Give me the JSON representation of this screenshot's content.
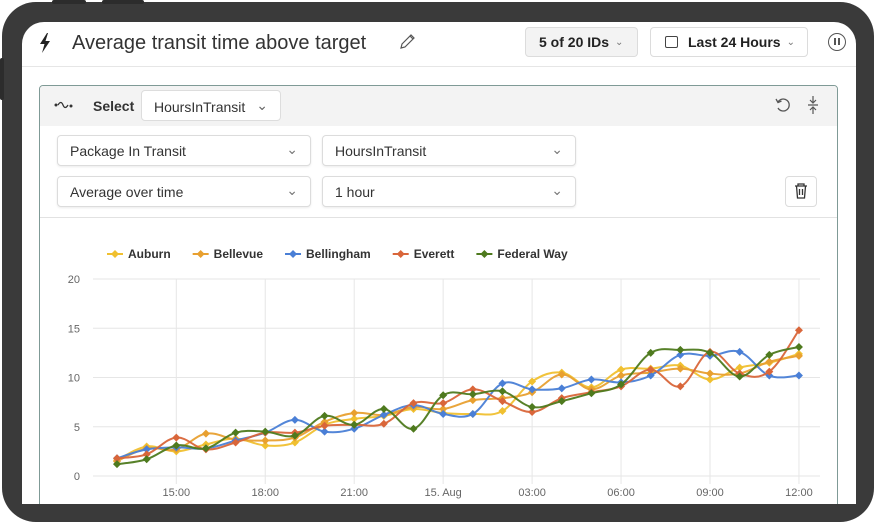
{
  "header": {
    "title": "Average transit time above target",
    "ids_selector": "5 of 20 IDs",
    "time_range": "Last 24 Hours"
  },
  "panel": {
    "select_label": "Select",
    "metric": "HoursInTransit",
    "dropdowns": {
      "entity": "Package In Transit",
      "property": "HoursInTransit",
      "aggregation": "Average over time",
      "interval": "1 hour"
    }
  },
  "icons": {
    "bolt": "lightning-icon",
    "edit": "pencil-icon",
    "calendar": "calendar-icon",
    "pause": "pause-icon",
    "wave": "trend-line-icon",
    "undo": "undo-icon",
    "collapse": "collapse-icon",
    "delete": "trash-icon"
  },
  "chart_data": {
    "type": "line",
    "title": "",
    "xlabel": "",
    "ylabel": "",
    "ylim": [
      0,
      20
    ],
    "yticks": [
      "0",
      "5",
      "10",
      "15",
      "20"
    ],
    "xticks": [
      {
        "label": "15:00",
        "hour": 2
      },
      {
        "label": "18:00",
        "hour": 5
      },
      {
        "label": "21:00",
        "hour": 8
      },
      {
        "label": "15. Aug",
        "hour": 11
      },
      {
        "label": "03:00",
        "hour": 14
      },
      {
        "label": "06:00",
        "hour": 17
      },
      {
        "label": "09:00",
        "hour": 20
      },
      {
        "label": "12:00",
        "hour": 23
      }
    ],
    "x_start": "13:00",
    "x_step": "1 hour",
    "grid": true,
    "legend_position": "top-left",
    "series": [
      {
        "name": "Auburn",
        "color": "#f0c030",
        "values": [
          1.6,
          3.0,
          2.5,
          3.2,
          3.8,
          3.1,
          3.4,
          5.2,
          5.8,
          6.1,
          6.8,
          6.4,
          6.3,
          6.6,
          9.6,
          10.5,
          9.0,
          10.8,
          10.9,
          11.2,
          9.8,
          11.0,
          11.5,
          12.4
        ]
      },
      {
        "name": "Bellevue",
        "color": "#e8a030",
        "values": [
          1.5,
          2.8,
          2.7,
          4.3,
          3.7,
          3.6,
          3.9,
          5.5,
          6.4,
          6.2,
          7.0,
          6.8,
          7.7,
          7.9,
          8.5,
          10.3,
          8.8,
          10.2,
          10.5,
          10.9,
          10.4,
          10.4,
          11.6,
          12.2
        ]
      },
      {
        "name": "Bellingham",
        "color": "#4a7fd6",
        "values": [
          1.8,
          2.7,
          2.9,
          2.8,
          3.6,
          4.4,
          5.7,
          4.5,
          4.8,
          6.2,
          7.2,
          6.3,
          6.3,
          9.4,
          8.8,
          8.9,
          9.8,
          9.5,
          10.2,
          12.3,
          12.2,
          12.6,
          10.2,
          10.2
        ]
      },
      {
        "name": "Everett",
        "color": "#d9663a",
        "values": [
          1.8,
          2.2,
          3.9,
          2.7,
          3.4,
          4.4,
          4.4,
          5.1,
          5.2,
          5.3,
          7.4,
          7.4,
          8.8,
          7.6,
          6.5,
          7.9,
          8.5,
          9.1,
          10.8,
          9.1,
          12.6,
          10.4,
          10.6,
          14.8
        ]
      },
      {
        "name": "Federal Way",
        "color": "#4e7a1e",
        "values": [
          1.2,
          1.7,
          3.1,
          2.8,
          4.4,
          4.5,
          4.1,
          6.1,
          5.2,
          6.8,
          4.8,
          8.2,
          8.3,
          8.6,
          7.0,
          7.6,
          8.4,
          9.3,
          12.5,
          12.8,
          12.5,
          10.1,
          12.3,
          13.1
        ]
      }
    ]
  }
}
